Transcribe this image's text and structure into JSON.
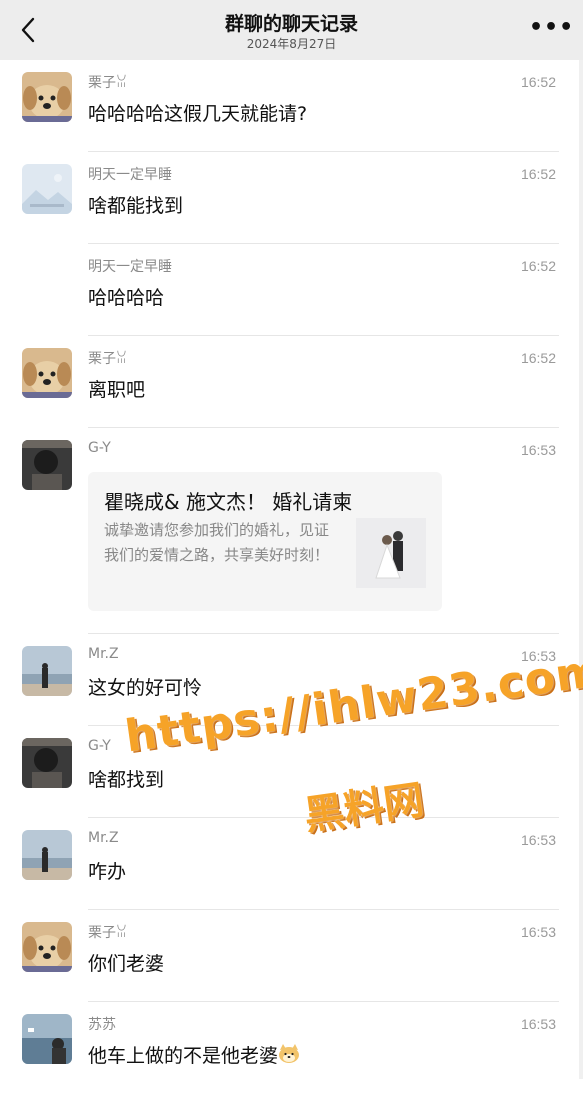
{
  "header": {
    "title": "群聊的聊天记录",
    "date": "2024年8月27日"
  },
  "messages": [
    {
      "sender": "栗子ꈍ",
      "time": "16:52",
      "text": "哈哈哈哈这假几天就能请?"
    },
    {
      "sender": "明天一定早睡",
      "time": "16:52",
      "text": "啥都能找到"
    },
    {
      "sender": "明天一定早睡",
      "time": "16:52",
      "text": "哈哈哈哈"
    },
    {
      "sender": "栗子ꈍ",
      "time": "16:52",
      "text": "离职吧"
    },
    {
      "sender": "G-Y",
      "time": "16:53",
      "card": {
        "title": "瞿晓成& 施文杰！ 婚礼请柬",
        "desc": "诚挚邀请您参加我们的婚礼，见证我们的爱情之路，共享美好时刻！"
      }
    },
    {
      "sender": "Mr.Z",
      "time": "16:53",
      "text": "这女的好可怜"
    },
    {
      "sender": "G-Y",
      "time": "",
      "text": "啥都找到"
    },
    {
      "sender": "Mr.Z",
      "time": "16:53",
      "text": "咋办"
    },
    {
      "sender": "栗子ꈍ",
      "time": "16:53",
      "text": "你们老婆"
    },
    {
      "sender": "苏苏",
      "time": "16:53",
      "text": "他车上做的不是他老婆"
    }
  ],
  "watermark": {
    "url": "https://ihlw23.com",
    "name": "黑料网"
  },
  "icons": {
    "back": "chevron-left-icon",
    "more": "more-dots-icon",
    "emoji": "doge-emoji-icon"
  },
  "colors": {
    "header_bg": "#ededed",
    "watermark": "#f6a328"
  }
}
